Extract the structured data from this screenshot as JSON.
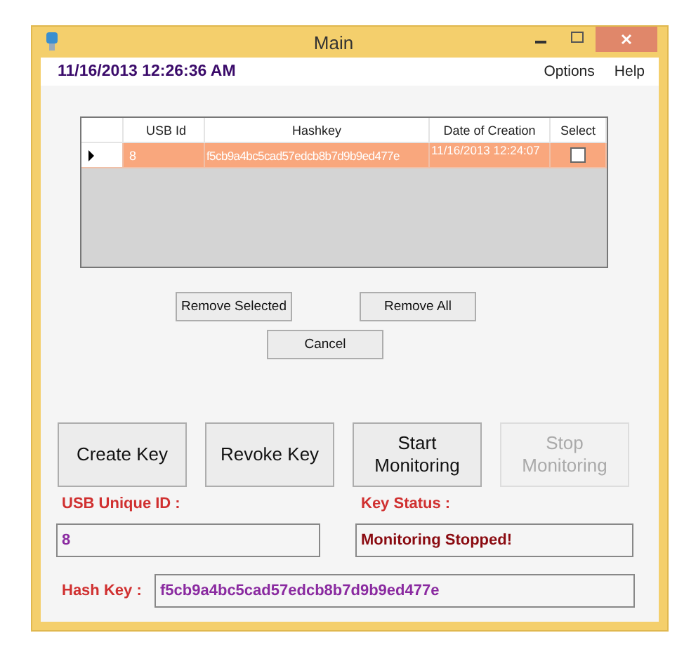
{
  "window": {
    "title": "Main"
  },
  "clock": "11/16/2013 12:26:36 AM",
  "menu": [
    "Options",
    "Help"
  ],
  "table": {
    "columns": [
      "USB Id",
      "Hashkey",
      "Date of Creation",
      "Select"
    ],
    "rows": [
      {
        "current": true,
        "selected": true,
        "usb_id": "8",
        "hashkey": "f5cb9a4bc5cad57edcb8b7d9b9ed477e",
        "date": "11/16/2013 12:24:07",
        "checked": false
      }
    ]
  },
  "list_buttons": [
    "Remove Selected",
    "Remove All"
  ],
  "cancel": "Cancel",
  "actions": [
    {
      "label": "Create Key",
      "disabled": false
    },
    {
      "label": "Revoke Key",
      "disabled": false
    },
    {
      "label": "Start Monitoring",
      "disabled": false
    },
    {
      "label": "Stop Monitoring",
      "disabled": true
    }
  ],
  "usb_id": {
    "label": "USB Unique ID :",
    "value": "8"
  },
  "key_status": {
    "label": "Key Status :",
    "value": "Monitoring Stopped!"
  },
  "hash_key": {
    "label": "Hash Key :",
    "value": "f5cb9a4bc5cad57edcb8b7d9b9ed477e"
  }
}
